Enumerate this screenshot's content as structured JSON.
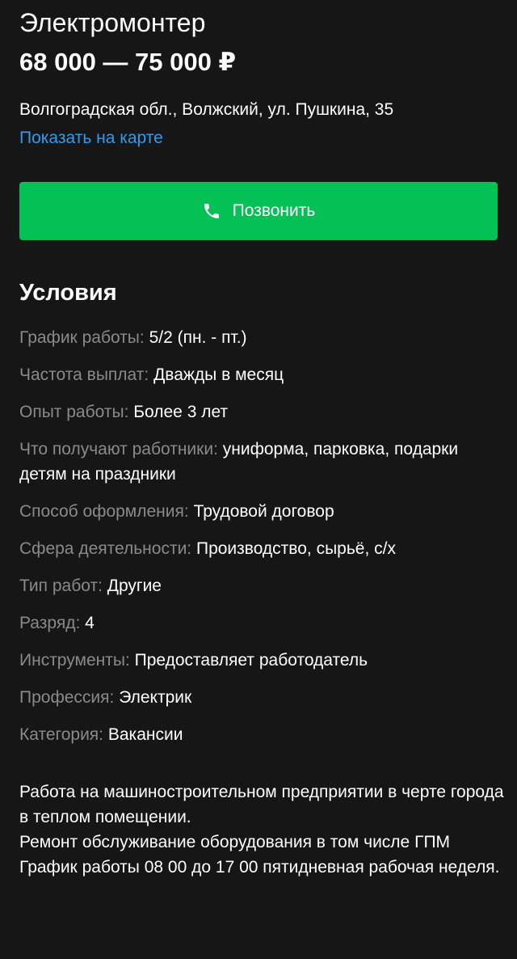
{
  "vacancy": {
    "title": "Электромонтер",
    "salary": "68 000 — 75 000 ₽",
    "address": "Волгоградская обл., Волжский, ул. Пушкина, 35",
    "map_link": "Показать на карте",
    "call_button_label": "Позвонить"
  },
  "conditions": {
    "title": "Условия",
    "items": [
      {
        "label": "График работы:",
        "value": "5/2 (пн. - пт.)"
      },
      {
        "label": "Частота выплат:",
        "value": "Дважды в месяц"
      },
      {
        "label": "Опыт работы:",
        "value": "Более 3 лет"
      },
      {
        "label": "Что получают работники:",
        "value": "униформа, парковка, подарки детям на праздники"
      },
      {
        "label": "Способ оформления:",
        "value": "Трудовой договор"
      },
      {
        "label": "Сфера деятельности:",
        "value": "Производство, сырьё, с/х"
      },
      {
        "label": "Тип работ:",
        "value": "Другие"
      },
      {
        "label": "Разряд:",
        "value": "4"
      },
      {
        "label": "Инструменты:",
        "value": "Предоставляет работодатель"
      },
      {
        "label": "Профессия:",
        "value": "Электрик"
      },
      {
        "label": "Категория:",
        "value": "Вакансии"
      }
    ]
  },
  "description": {
    "lines": [
      "Работа на машиностроительном предприятии в черте города в теплом  помещении.",
      "Ремонт обслуживание оборудования в том числе ГПМ",
      "График работы 08 00 до 17 00 пятидневная рабочая неделя."
    ]
  },
  "icons": {
    "call": "phone-icon"
  },
  "colors": {
    "background": "#161616",
    "accent_green": "#04c155",
    "link_blue": "#2d9cf5",
    "label_gray": "#8a8a8a"
  }
}
